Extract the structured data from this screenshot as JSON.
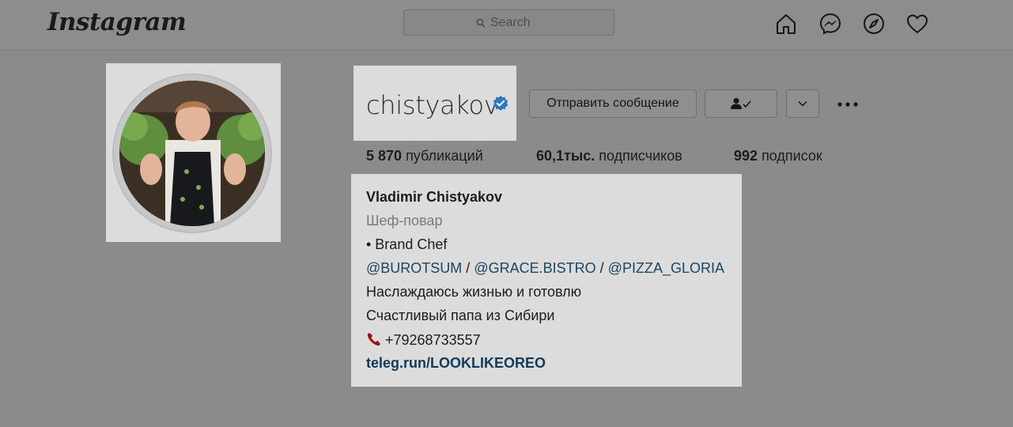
{
  "app": {
    "logo": "Instagram"
  },
  "header": {
    "search_placeholder": "Search",
    "nav_icons": [
      "home-icon",
      "messenger-icon",
      "explore-icon",
      "heart-icon"
    ]
  },
  "profile": {
    "username": "chistyakov",
    "verified": true,
    "actions": {
      "message_label": "Отправить сообщение",
      "following_icon": "person-check-icon",
      "suggest_icon": "chevron-down-icon",
      "more_icon": "more-dots-icon"
    },
    "stats": {
      "posts_value": "5 870",
      "posts_label": "публикаций",
      "followers_value": "60,1тыс.",
      "followers_label": "подписчиков",
      "following_value": "992",
      "following_label": "подписок"
    },
    "bio": {
      "full_name": "Vladimir Chistyakov",
      "category": "Шеф-повар",
      "line1": "• Brand Chef",
      "tags": [
        "@BUROTSUM",
        "@GRACE.BISTRO",
        "@PIZZA_GLORIA"
      ],
      "tag_separator": "/",
      "line2": "Наслаждаюсь жизнью и готовлю",
      "line3": "Счастливый папа из Сибири",
      "phone": "+79268733557",
      "link": "teleg.run/LOOKLIKEOREO"
    }
  },
  "colors": {
    "verified_badge": "#3897f0",
    "tag_link": "#1b4563",
    "overlay_bg": "#8b8b8b",
    "highlight_bg": "#dcdcdc"
  }
}
